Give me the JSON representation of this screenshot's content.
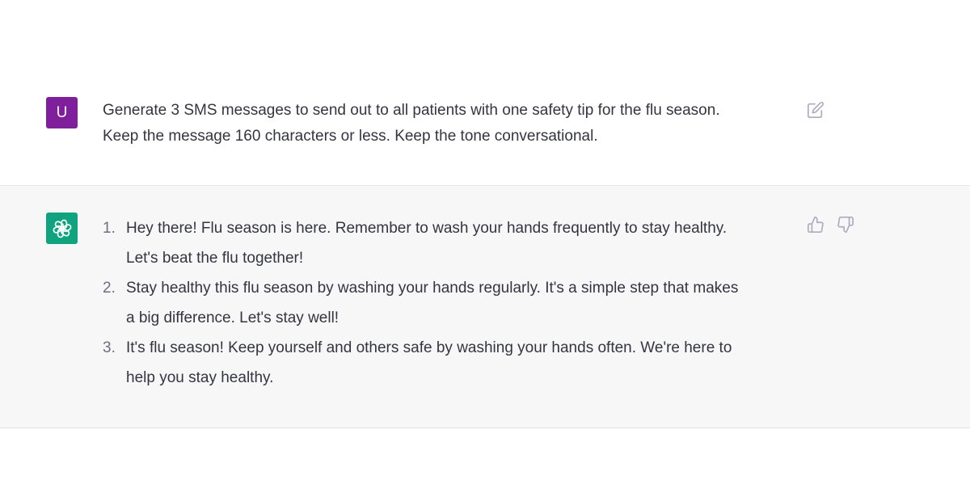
{
  "user_message": {
    "avatar_initial": "U",
    "avatar_color": "#7f1f9b",
    "lines": [
      "Generate 3 SMS messages to send out to all patients with one safety tip for the flu season.",
      "Keep the message 160 characters or less. Keep the tone conversational."
    ],
    "edit_icon": "edit-icon"
  },
  "assistant_message": {
    "avatar_icon": "openai-logo-icon",
    "avatar_color": "#10a37f",
    "items": [
      {
        "number": "1.",
        "lines": [
          "Hey there! Flu season is here. Remember to wash your hands frequently to stay healthy.",
          "Let's beat the flu together!"
        ]
      },
      {
        "number": "2.",
        "lines": [
          "Stay healthy this flu season by washing your hands regularly. It's a simple step that makes",
          "a big difference. Let's stay well!"
        ]
      },
      {
        "number": "3.",
        "lines": [
          "It's flu season! Keep yourself and others safe by washing your hands often. We're here to",
          "help you stay healthy."
        ]
      }
    ],
    "feedback_icons": [
      "thumbs-up-icon",
      "thumbs-down-icon"
    ]
  }
}
